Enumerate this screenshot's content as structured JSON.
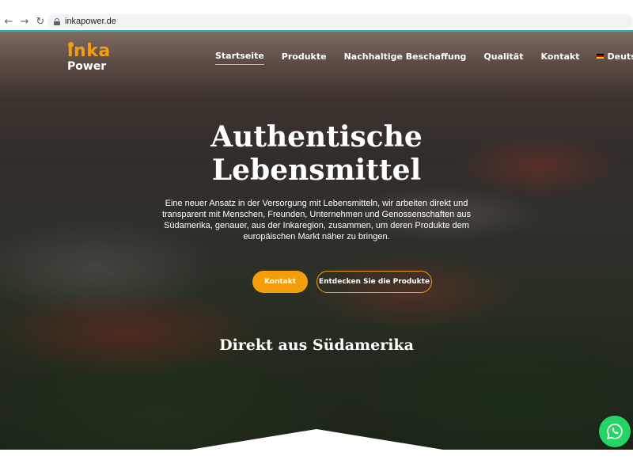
{
  "browser": {
    "url": "inkapower.de"
  },
  "logo": {
    "line1": "inka",
    "line2": "Power"
  },
  "nav": {
    "items": [
      "Startseite",
      "Produkte",
      "Nachhaltige Beschaffung",
      "Qualität",
      "Kontakt"
    ],
    "active_index": 0,
    "language": "Deutsch"
  },
  "hero": {
    "title_line1": "Authentische",
    "title_line2": "Lebensmittel",
    "description": "Eine neuer Ansatz in der Versorgung mit Lebensmitteln, wir arbeiten direkt und transparent mit Menschen, Freunden, Unternehmen und Genossenschaften aus Südamerika, genauer, aus der Inkaregion, zusammen, um deren Produkte dem europäischen Markt näher zu bringen.",
    "primary_button": "Kontakt",
    "secondary_button": "Entdecken Sie die Produkte",
    "subtitle": "Direkt aus Südamerika"
  },
  "colors": {
    "accent": "#f59e0b",
    "whatsapp": "#25d366",
    "chrome_line": "#2bb5c9"
  },
  "icons": {
    "back": "arrow-left-icon",
    "forward": "arrow-right-icon",
    "reload": "reload-icon",
    "lock": "lock-icon",
    "language_flag": "german-flag-icon",
    "dropdown": "chevron-down-icon",
    "chat": "whatsapp-icon"
  }
}
